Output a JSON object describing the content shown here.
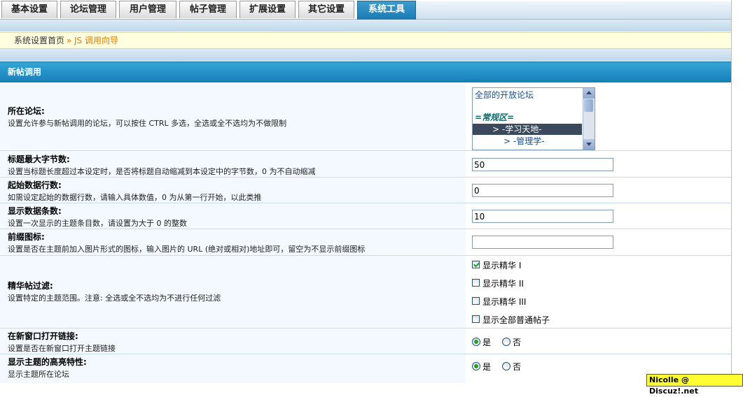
{
  "tabs": [
    {
      "label": "基本设置",
      "active": false
    },
    {
      "label": "论坛管理",
      "active": false
    },
    {
      "label": "用户管理",
      "active": false
    },
    {
      "label": "帖子管理",
      "active": false
    },
    {
      "label": "扩展设置",
      "active": false
    },
    {
      "label": "其它设置",
      "active": false
    },
    {
      "label": "系统工具",
      "active": true
    }
  ],
  "breadcrumb": {
    "home": "系统设置首页",
    "separator": "»",
    "current": "JS 调用向导"
  },
  "section_title": "新帖调用",
  "forums": {
    "label": "所在论坛:",
    "description": "设置允许参与新帖调用的论坛，可以按住 CTRL 多选，全选或全不选均为不做限制",
    "options": [
      "全部的开放论坛",
      "",
      "=常规区=",
      "> -学习天地-",
      "> -管理学-"
    ],
    "selected_option": "> -学习天地-"
  },
  "title_max_bytes": {
    "label": "标题最大字节数:",
    "description": "设置当标题长度超过本设定时，是否将标题自动缩减到本设定中的字节数，0 为不自动缩减",
    "value": "50"
  },
  "start_row": {
    "label": "起始数据行数:",
    "description": "如需设定起始的数据行数，请输入具体数值，0 为从第一行开始，以此类推",
    "value": "0"
  },
  "display_count": {
    "label": "显示数据条数:",
    "description": "设置一次显示的主题条目数，请设置为大于 0 的整数",
    "value": "10"
  },
  "prefix_icon": {
    "label": "前缀图标:",
    "description": "设置是否在主题前加入图片形式的图标，输入图片的 URL (绝对或相对)地址即可，留空为不显示前缀图标",
    "value": ""
  },
  "digest_filter": {
    "label": "精华帖过滤:",
    "description": "设置特定的主题范围。注意: 全选或全不选均为不进行任何过滤",
    "options": [
      {
        "label": "显示精华 I",
        "checked": true
      },
      {
        "label": "显示精华 II",
        "checked": false
      },
      {
        "label": "显示精华 III",
        "checked": false
      },
      {
        "label": "显示全部普通帖子",
        "checked": false
      }
    ]
  },
  "new_window": {
    "label": "在新窗口打开链接:",
    "description": "设置是否在新窗口打开主题链接",
    "yes": "是",
    "no": "否",
    "selected": "yes"
  },
  "highlight": {
    "label": "显示主题的高亮特性:",
    "description": "显示主题所在论坛",
    "yes": "是",
    "no": "否",
    "selected": "yes"
  },
  "watermark": "Nicolle @ Discuz!.net",
  "colors": {
    "accent_blue": "#1b7ab3",
    "row_bg": "#f3f9fe",
    "crumb_link": "#e07b00",
    "highlight_yellow": "#ffff33"
  }
}
